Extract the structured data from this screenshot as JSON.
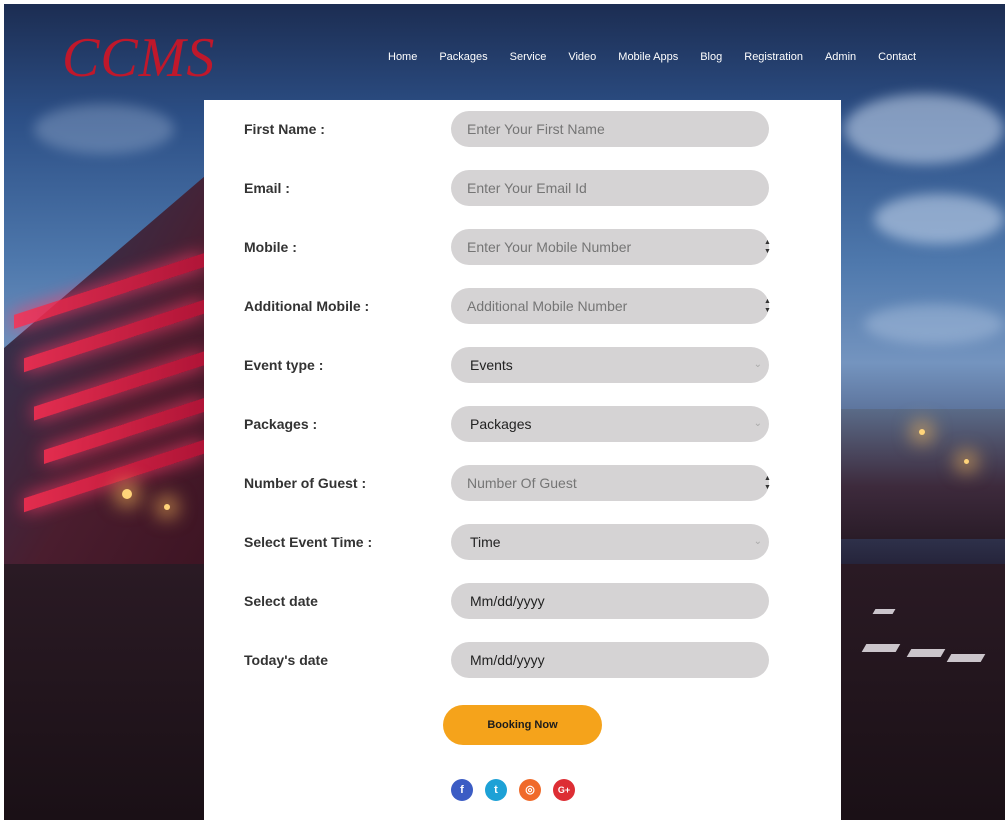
{
  "brand": {
    "logo": "CCMS",
    "logo_color": "#c0182b"
  },
  "nav": {
    "items": [
      "Home",
      "Packages",
      "Service",
      "Video",
      "Mobile Apps",
      "Blog",
      "Registration",
      "Admin",
      "Contact"
    ]
  },
  "form": {
    "first_name": {
      "label": "First Name :",
      "placeholder": "Enter Your First Name"
    },
    "email": {
      "label": "Email :",
      "placeholder": "Enter Your Email Id"
    },
    "mobile": {
      "label": "Mobile :",
      "placeholder": "Enter Your Mobile Number"
    },
    "additional_mobile": {
      "label": "Additional Mobile :",
      "placeholder": "Additional Mobile Number"
    },
    "event_type": {
      "label": "Event type :",
      "value": "Events"
    },
    "packages": {
      "label": "Packages :",
      "value": "Packages"
    },
    "guests": {
      "label": "Number of Guest :",
      "placeholder": "Number Of Guest"
    },
    "event_time": {
      "label": "Select Event Time :",
      "value": "Time"
    },
    "select_date": {
      "label": "Select date",
      "value": "Mm/dd/yyyy"
    },
    "todays_date": {
      "label": "Today's date",
      "value": "Mm/dd/yyyy"
    },
    "submit_label": "Booking Now"
  },
  "social": {
    "facebook": "f",
    "twitter": "t",
    "instagram": "◎",
    "google_plus": "G+"
  },
  "colors": {
    "accent_button": "#f5a31b",
    "field_bg": "#d5d3d4",
    "facebook": "#3b5cc4",
    "twitter": "#1da1d6",
    "instagram": "#f06a2a",
    "google_plus": "#dd2e34"
  }
}
